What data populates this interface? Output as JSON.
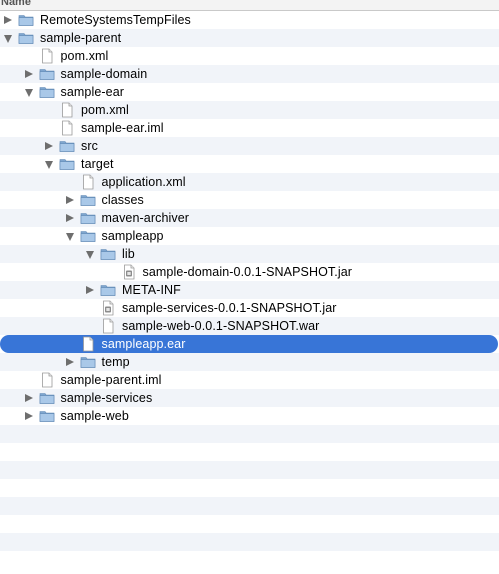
{
  "header": {
    "name_column": "Name"
  },
  "tree": [
    {
      "label": "RemoteSystemsTempFiles",
      "type": "folder",
      "depth": 0,
      "expand": "closed"
    },
    {
      "label": "sample-parent",
      "type": "folder",
      "depth": 0,
      "expand": "open"
    },
    {
      "label": "pom.xml",
      "type": "file",
      "depth": 1,
      "expand": "none"
    },
    {
      "label": "sample-domain",
      "type": "folder",
      "depth": 1,
      "expand": "closed"
    },
    {
      "label": "sample-ear",
      "type": "folder",
      "depth": 1,
      "expand": "open"
    },
    {
      "label": "pom.xml",
      "type": "file",
      "depth": 2,
      "expand": "none"
    },
    {
      "label": "sample-ear.iml",
      "type": "file",
      "depth": 2,
      "expand": "none"
    },
    {
      "label": "src",
      "type": "folder",
      "depth": 2,
      "expand": "closed"
    },
    {
      "label": "target",
      "type": "folder",
      "depth": 2,
      "expand": "open"
    },
    {
      "label": "application.xml",
      "type": "file",
      "depth": 3,
      "expand": "none"
    },
    {
      "label": "classes",
      "type": "folder",
      "depth": 3,
      "expand": "closed"
    },
    {
      "label": "maven-archiver",
      "type": "folder",
      "depth": 3,
      "expand": "closed"
    },
    {
      "label": "sampleapp",
      "type": "folder",
      "depth": 3,
      "expand": "open"
    },
    {
      "label": "lib",
      "type": "folder",
      "depth": 4,
      "expand": "open"
    },
    {
      "label": "sample-domain-0.0.1-SNAPSHOT.jar",
      "type": "jar",
      "depth": 5,
      "expand": "none"
    },
    {
      "label": "META-INF",
      "type": "folder",
      "depth": 4,
      "expand": "closed"
    },
    {
      "label": "sample-services-0.0.1-SNAPSHOT.jar",
      "type": "jar",
      "depth": 4,
      "expand": "none"
    },
    {
      "label": "sample-web-0.0.1-SNAPSHOT.war",
      "type": "file",
      "depth": 4,
      "expand": "none"
    },
    {
      "label": "sampleapp.ear",
      "type": "file",
      "depth": 3,
      "expand": "none",
      "selected": true
    },
    {
      "label": "temp",
      "type": "folder",
      "depth": 3,
      "expand": "closed"
    },
    {
      "label": "sample-parent.iml",
      "type": "file",
      "depth": 1,
      "expand": "none"
    },
    {
      "label": "sample-services",
      "type": "folder",
      "depth": 1,
      "expand": "closed"
    },
    {
      "label": "sample-web",
      "type": "folder",
      "depth": 1,
      "expand": "closed"
    }
  ],
  "empty_rows": 8,
  "colors": {
    "selection": "#3875d7",
    "alternate_row": "#f1f4f9",
    "folder_light": "#a9c8e8",
    "folder_dark": "#7fa6cf"
  }
}
